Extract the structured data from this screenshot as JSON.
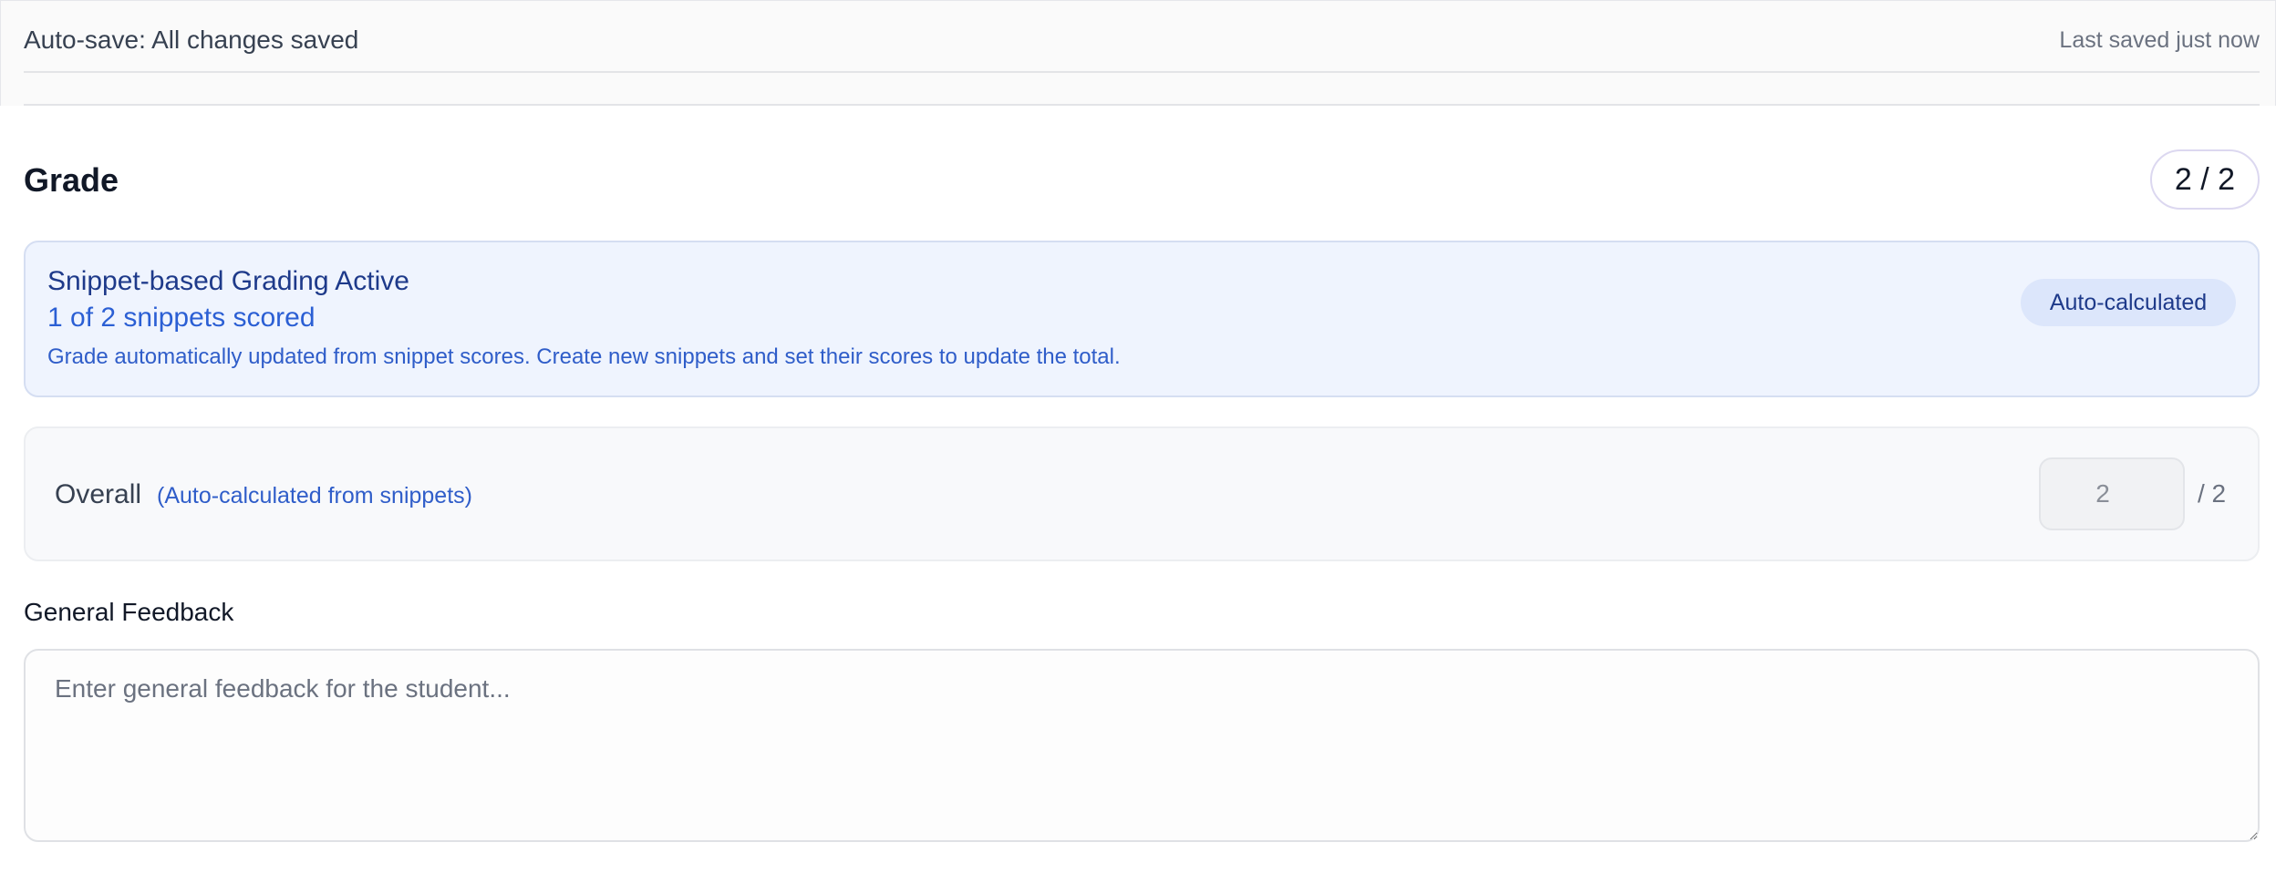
{
  "autosave": {
    "status": "Auto-save: All changes saved",
    "last_saved": "Last saved just now"
  },
  "grade": {
    "title": "Grade",
    "score_badge": "2 / 2",
    "snippet_banner": {
      "title": "Snippet-based Grading Active",
      "count": "1 of 2 snippets scored",
      "description": "Grade automatically updated from snippet scores. Create new snippets and set their scores to update the total.",
      "badge": "Auto-calculated"
    },
    "overall": {
      "label": "Overall",
      "note": "(Auto-calculated from snippets)",
      "value": "2",
      "max": "/ 2"
    }
  },
  "feedback": {
    "label": "General Feedback",
    "placeholder": "Enter general feedback for the student...",
    "value": ""
  },
  "colors": {
    "banner_bg": "#eff4fe",
    "banner_title": "#1e3a8a",
    "accent_blue": "#2f5dc9",
    "pill_bg": "#dce6fb"
  }
}
